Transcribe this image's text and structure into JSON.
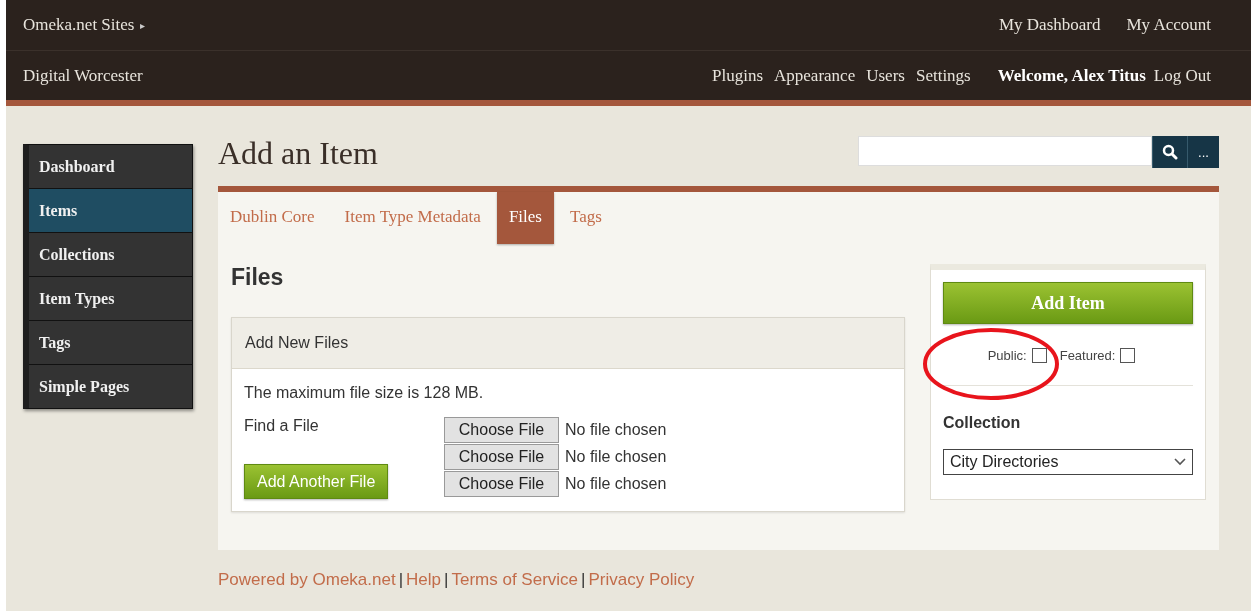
{
  "top_bar": {
    "site_switcher": "Omeka.net Sites",
    "caret": "▸",
    "links": [
      "My Dashboard",
      "My Account"
    ]
  },
  "admin_bar": {
    "site_title": "Digital Worcester",
    "nav": [
      "Plugins",
      "Appearance",
      "Users",
      "Settings"
    ],
    "welcome": "Welcome, Alex Titus",
    "logout": "Log Out"
  },
  "sidebar": {
    "items": [
      {
        "label": "Dashboard",
        "selected": false
      },
      {
        "label": "Items",
        "selected": true
      },
      {
        "label": "Collections",
        "selected": false
      },
      {
        "label": "Item Types",
        "selected": false
      },
      {
        "label": "Tags",
        "selected": false
      },
      {
        "label": "Simple Pages",
        "selected": false
      }
    ]
  },
  "page_title": "Add an Item",
  "search": {
    "more_button": "..."
  },
  "tabs": [
    {
      "label": "Dublin Core",
      "selected": false
    },
    {
      "label": "Item Type Metadata",
      "selected": false
    },
    {
      "label": "Files",
      "selected": true
    },
    {
      "label": "Tags",
      "selected": false
    }
  ],
  "section_title": "Files",
  "files_box": {
    "title": "Add New Files",
    "max_size_note": "The maximum file size is 128 MB.",
    "find_label": "Find a File",
    "add_another_button": "Add Another File",
    "file_inputs": [
      {
        "button": "Choose File",
        "status": "No file chosen"
      },
      {
        "button": "Choose File",
        "status": "No file chosen"
      },
      {
        "button": "Choose File",
        "status": "No file chosen"
      }
    ]
  },
  "save_panel": {
    "add_button": "Add Item",
    "checkboxes": [
      {
        "label": "Public:",
        "checked": false
      },
      {
        "label": "Featured:",
        "checked": false
      }
    ],
    "collection_label": "Collection",
    "collection": {
      "value": "City Directories"
    }
  },
  "footer": {
    "items": [
      {
        "kind": "link",
        "text": "Powered by Omeka.net"
      },
      {
        "kind": "separator",
        "text": "|"
      },
      {
        "kind": "link",
        "text": "Help"
      },
      {
        "kind": "separator",
        "text": "|"
      },
      {
        "kind": "link",
        "text": "Terms of Service"
      },
      {
        "kind": "separator",
        "text": "|"
      },
      {
        "kind": "link",
        "text": "Privacy Policy"
      }
    ]
  },
  "annotation": {
    "kind": "ellipse"
  }
}
